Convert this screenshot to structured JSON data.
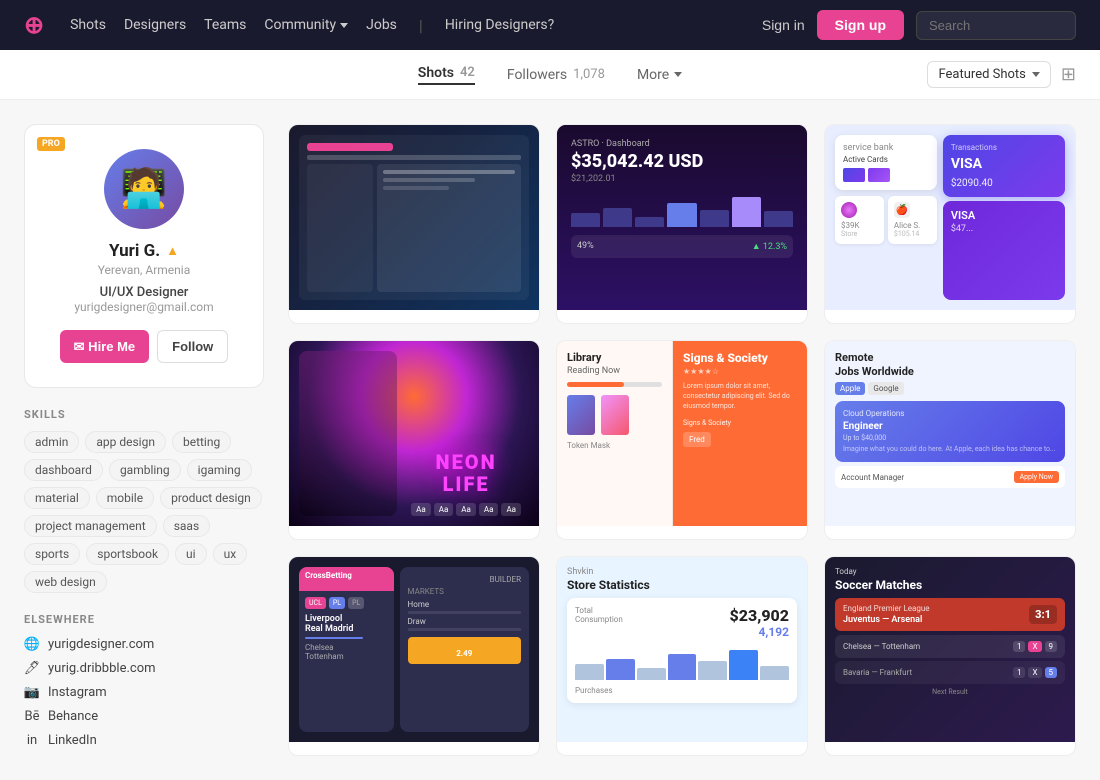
{
  "nav": {
    "logo": "dribbble",
    "links": [
      {
        "label": "Shots",
        "id": "shots"
      },
      {
        "label": "Designers",
        "id": "designers"
      },
      {
        "label": "Teams",
        "id": "teams"
      },
      {
        "label": "Community",
        "id": "community"
      },
      {
        "label": "Jobs",
        "id": "jobs"
      },
      {
        "label": "Hiring Designers?",
        "id": "hiring"
      }
    ],
    "signin_label": "Sign in",
    "signup_label": "Sign up",
    "search_placeholder": "Search"
  },
  "tabs": {
    "shots_label": "Shots",
    "shots_count": "42",
    "followers_label": "Followers",
    "followers_count": "1,078",
    "more_label": "More",
    "featured_label": "Featured Shots",
    "grid_icon": "⊞"
  },
  "profile": {
    "pro_badge": "PRO",
    "name": "Yuri G.",
    "location": "Yerevan, Armenia",
    "role": "UI/UX Designer",
    "email": "yurigdesigner@gmail.com",
    "hire_label": "✉ Hire Me",
    "follow_label": "Follow",
    "up_arrow": "▲"
  },
  "skills": {
    "section_label": "SKILLS",
    "tags": [
      "admin",
      "app design",
      "betting",
      "dashboard",
      "gambling",
      "igaming",
      "material",
      "mobile",
      "product design",
      "project management",
      "saas",
      "sports",
      "sportsbook",
      "ui",
      "ux",
      "web design"
    ]
  },
  "elsewhere": {
    "section_label": "ELSEWHERE",
    "links": [
      {
        "label": "yurigdesigner.com",
        "icon": "🌐",
        "id": "website"
      },
      {
        "label": "yurig.dribbble.com",
        "icon": "🖊",
        "id": "dribbble"
      },
      {
        "label": "Instagram",
        "icon": "📷",
        "id": "instagram"
      },
      {
        "label": "Behance",
        "icon": "Bē",
        "id": "behance"
      },
      {
        "label": "LinkedIn",
        "icon": "in",
        "id": "linkedin"
      }
    ]
  },
  "shots": [
    {
      "id": "shot-1",
      "theme": "sports-dark"
    },
    {
      "id": "shot-2",
      "theme": "finance-purple"
    },
    {
      "id": "shot-3",
      "theme": "wallet-light"
    },
    {
      "id": "shot-4",
      "theme": "neon-life"
    },
    {
      "id": "shot-5",
      "theme": "library-orange"
    },
    {
      "id": "shot-6",
      "theme": "remote-jobs"
    },
    {
      "id": "shot-7",
      "theme": "crossfit"
    },
    {
      "id": "shot-8",
      "theme": "store-stats"
    },
    {
      "id": "shot-9",
      "theme": "soccer"
    }
  ],
  "colors": {
    "brand_pink": "#e84393",
    "nav_bg": "#1a1a2e",
    "accent_blue": "#667eea",
    "accent_orange": "#f5a623"
  }
}
